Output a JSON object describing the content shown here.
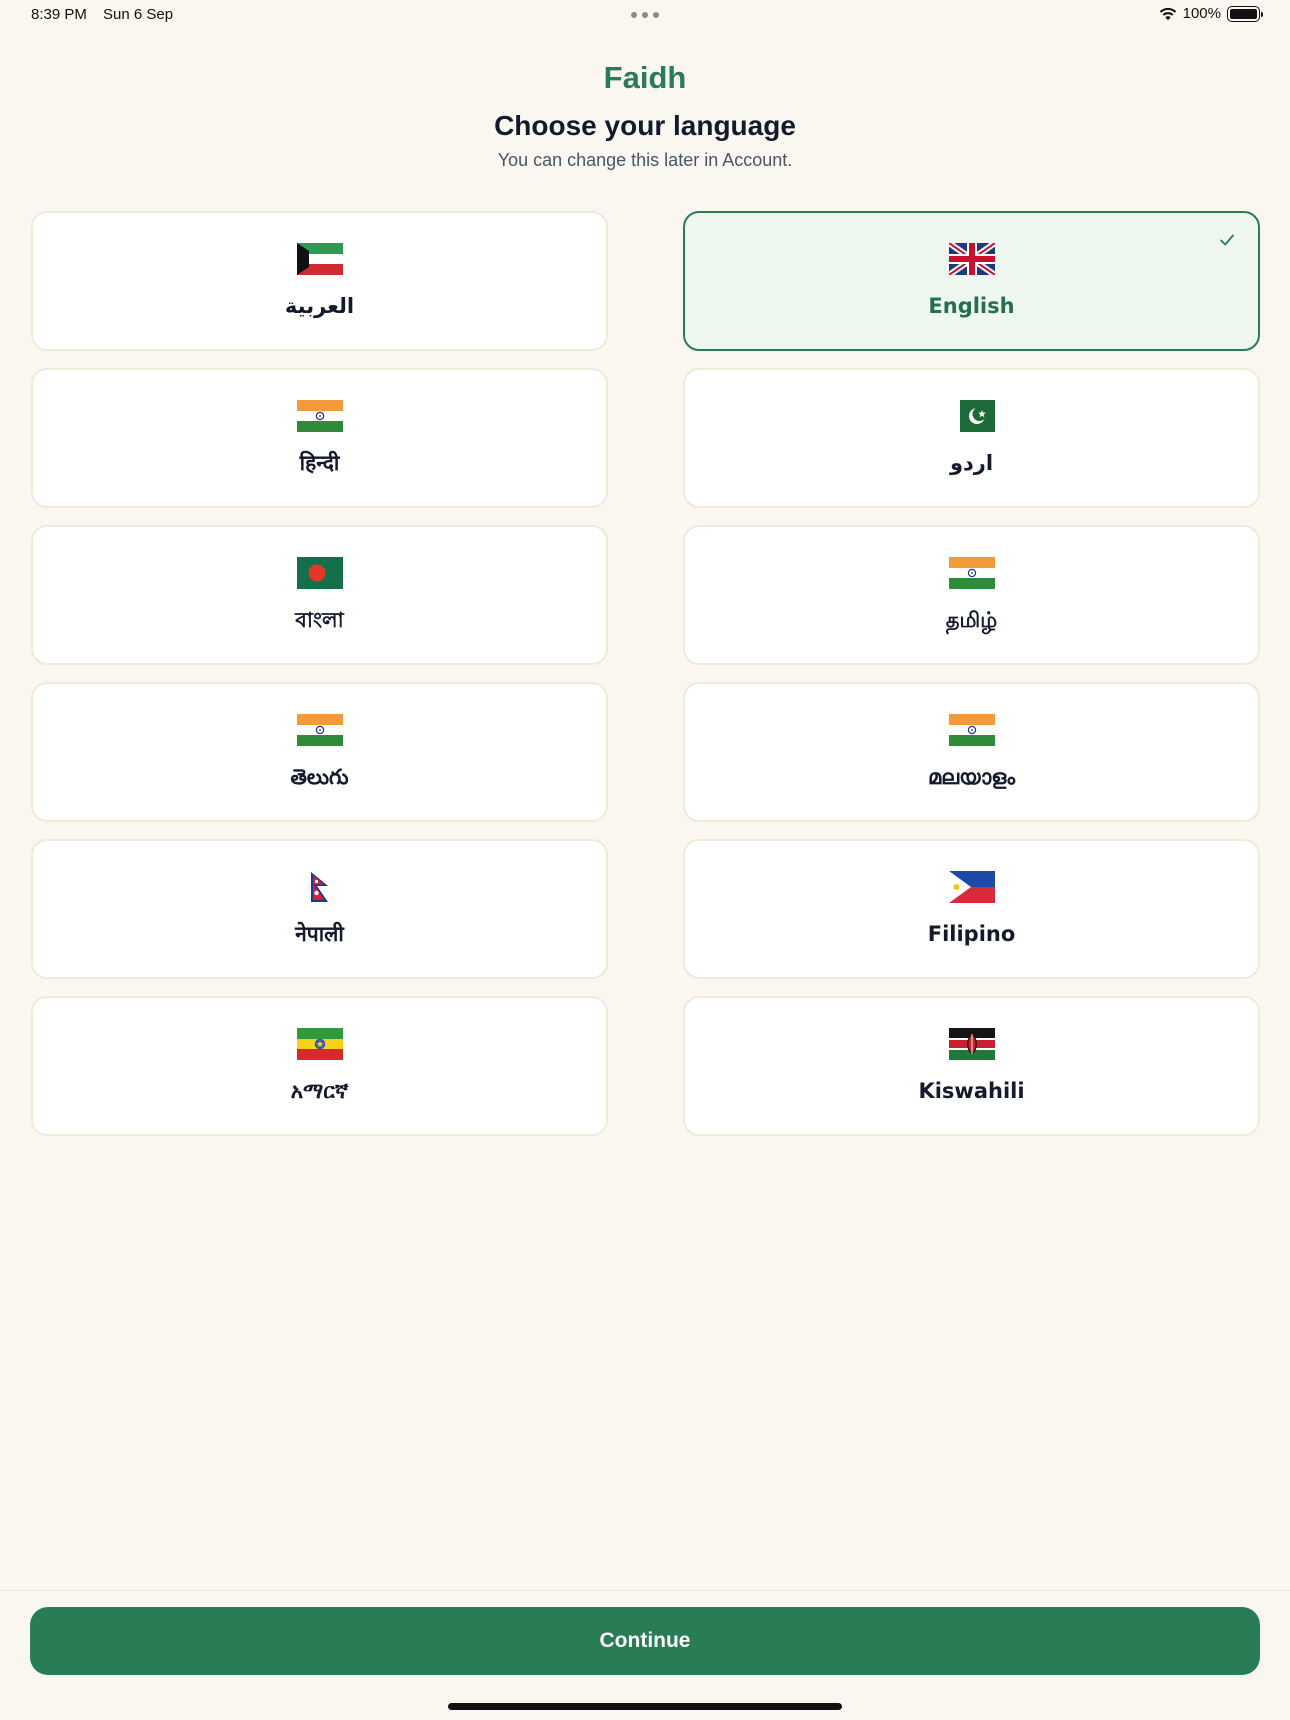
{
  "status_bar": {
    "time": "8:39 PM",
    "date": "Sun 6 Sep",
    "battery": "100%"
  },
  "header": {
    "brand": "Faidh",
    "title": "Choose your language",
    "subtitle": "You can change this later in Account."
  },
  "languages": [
    {
      "label": "العربية",
      "flag_icon": "kuwait-flag-icon",
      "selected": false
    },
    {
      "label": "English",
      "flag_icon": "uk-flag-icon",
      "selected": true
    },
    {
      "label": "हिन्दी",
      "flag_icon": "india-flag-icon",
      "selected": false
    },
    {
      "label": "اردو",
      "flag_icon": "pakistan-flag-icon",
      "selected": false
    },
    {
      "label": "বাংলা",
      "flag_icon": "bangladesh-flag-icon",
      "selected": false
    },
    {
      "label": "தமிழ்",
      "flag_icon": "india-flag-icon",
      "selected": false
    },
    {
      "label": "తెలుగు",
      "flag_icon": "india-flag-icon",
      "selected": false
    },
    {
      "label": "മലയാളം",
      "flag_icon": "india-flag-icon",
      "selected": false
    },
    {
      "label": "नेपाली",
      "flag_icon": "nepal-flag-icon",
      "selected": false
    },
    {
      "label": "Filipino",
      "flag_icon": "philippines-flag-icon",
      "selected": false
    },
    {
      "label": "አማርኛ",
      "flag_icon": "ethiopia-flag-icon",
      "selected": false
    },
    {
      "label": "Kiswahili",
      "flag_icon": "kenya-flag-icon",
      "selected": false
    }
  ],
  "continue_label": "Continue",
  "colors": {
    "brand": "#2a7c52",
    "button": "#287d54",
    "background": "#faf7f1",
    "selected_bg": "#eff7f1"
  }
}
